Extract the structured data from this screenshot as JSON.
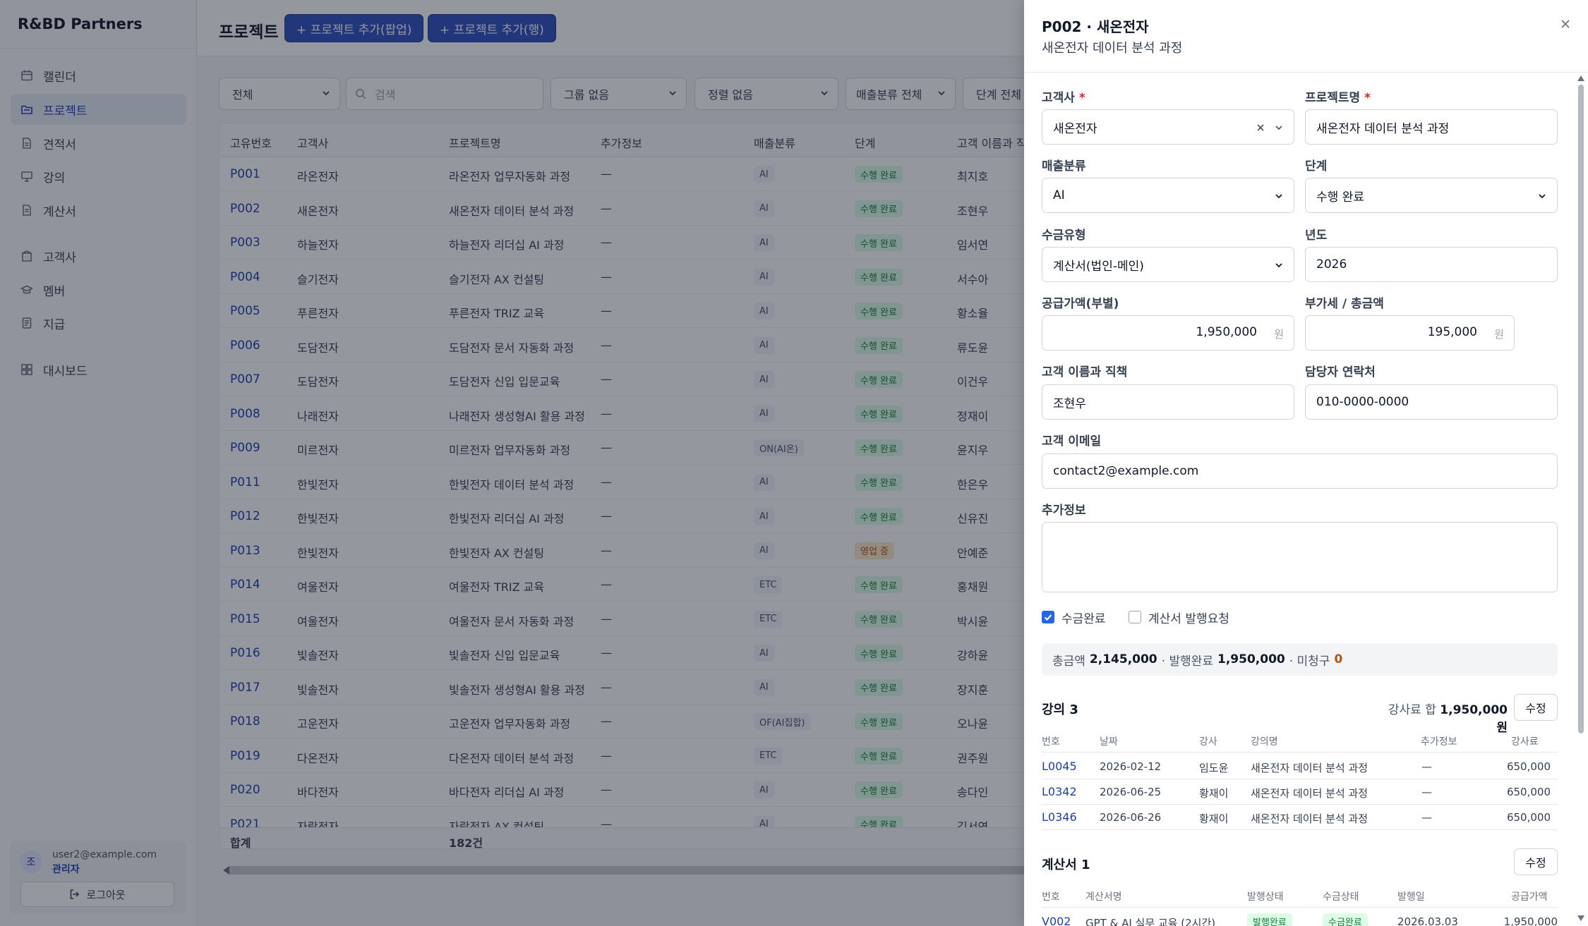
{
  "sidebar": {
    "brand": "R&BD Partners",
    "items": [
      {
        "label": "캘린더",
        "icon": "calendar-icon"
      },
      {
        "label": "프로젝트",
        "icon": "folder-icon",
        "active": true
      },
      {
        "label": "견적서",
        "icon": "document-icon"
      },
      {
        "label": "강의",
        "icon": "presentation-icon"
      },
      {
        "label": "계산서",
        "icon": "receipt-icon"
      },
      {
        "label": "고객사",
        "icon": "building-icon"
      },
      {
        "label": "멤버",
        "icon": "graduation-cap-icon"
      },
      {
        "label": "지급",
        "icon": "payment-icon"
      },
      {
        "label": "대시보드",
        "icon": "dashboard-icon"
      }
    ],
    "user": {
      "avatar": "조",
      "email": "user2@example.com",
      "role": "관리자",
      "logout": "로그아웃"
    }
  },
  "header": {
    "title": "프로젝트",
    "add_popup": "+ 프로젝트 추가(팝업)",
    "add_row": "+ 프로젝트 추가(행)"
  },
  "filters": {
    "scope": "전체",
    "search_placeholder": "검색",
    "group": "그룹 없음",
    "sort": "정렬 없음",
    "sales_class": "매출분류 전체",
    "stage": "단계 전체"
  },
  "table": {
    "columns": [
      "고유번호",
      "고객사",
      "프로젝트명",
      "추가정보",
      "매출분류",
      "단계",
      "고객 이름과 직책"
    ],
    "rows": [
      {
        "code": "P001",
        "client": "라온전자",
        "name": "라온전자 업무자동화 과정",
        "extra": "—",
        "cls": "AI",
        "stage": "수행 완료",
        "contact": "최지호"
      },
      {
        "code": "P002",
        "client": "새온전자",
        "name": "새온전자 데이터 분석 과정",
        "extra": "—",
        "cls": "AI",
        "stage": "수행 완료",
        "contact": "조현우"
      },
      {
        "code": "P003",
        "client": "하늘전자",
        "name": "하늘전자 리더십 AI 과정",
        "extra": "—",
        "cls": "AI",
        "stage": "수행 완료",
        "contact": "임서연"
      },
      {
        "code": "P004",
        "client": "슬기전자",
        "name": "슬기전자 AX 컨설팅",
        "extra": "—",
        "cls": "AI",
        "stage": "수행 완료",
        "contact": "서수아"
      },
      {
        "code": "P005",
        "client": "푸른전자",
        "name": "푸른전자 TRIZ 교육",
        "extra": "—",
        "cls": "AI",
        "stage": "수행 완료",
        "contact": "황소율"
      },
      {
        "code": "P006",
        "client": "도담전자",
        "name": "도담전자 문서 자동화 과정",
        "extra": "—",
        "cls": "AI",
        "stage": "수행 완료",
        "contact": "류도윤"
      },
      {
        "code": "P007",
        "client": "도담전자",
        "name": "도담전자 신입 입문교육",
        "extra": "—",
        "cls": "AI",
        "stage": "수행 완료",
        "contact": "이건우"
      },
      {
        "code": "P008",
        "client": "나래전자",
        "name": "나래전자 생성형AI 활용 과정",
        "extra": "—",
        "cls": "AI",
        "stage": "수행 완료",
        "contact": "정재이"
      },
      {
        "code": "P009",
        "client": "미르전자",
        "name": "미르전자 업무자동화 과정",
        "extra": "—",
        "cls": "ON(AI온)",
        "stage": "수행 완료",
        "contact": "윤지우"
      },
      {
        "code": "P011",
        "client": "한빛전자",
        "name": "한빛전자 데이터 분석 과정",
        "extra": "—",
        "cls": "AI",
        "stage": "수행 완료",
        "contact": "한은우"
      },
      {
        "code": "P012",
        "client": "한빛전자",
        "name": "한빛전자 리더십 AI 과정",
        "extra": "—",
        "cls": "AI",
        "stage": "수행 완료",
        "contact": "신유진"
      },
      {
        "code": "P013",
        "client": "한빛전자",
        "name": "한빛전자 AX 컨설팅",
        "extra": "—",
        "cls": "AI",
        "stage": "영업 중",
        "contact": "안예준"
      },
      {
        "code": "P014",
        "client": "여울전자",
        "name": "여울전자 TRIZ 교육",
        "extra": "—",
        "cls": "ETC",
        "stage": "수행 완료",
        "contact": "홍채원"
      },
      {
        "code": "P015",
        "client": "여울전자",
        "name": "여울전자 문서 자동화 과정",
        "extra": "—",
        "cls": "ETC",
        "stage": "수행 완료",
        "contact": "박시윤"
      },
      {
        "code": "P016",
        "client": "빛솔전자",
        "name": "빛솔전자 신입 입문교육",
        "extra": "—",
        "cls": "AI",
        "stage": "수행 완료",
        "contact": "강하윤"
      },
      {
        "code": "P017",
        "client": "빛솔전자",
        "name": "빛솔전자 생성형AI 활용 과정",
        "extra": "—",
        "cls": "AI",
        "stage": "수행 완료",
        "contact": "장지훈"
      },
      {
        "code": "P018",
        "client": "고운전자",
        "name": "고운전자 업무자동화 과정",
        "extra": "—",
        "cls": "OF(AI집합)",
        "stage": "수행 완료",
        "contact": "오나윤"
      },
      {
        "code": "P019",
        "client": "다온전자",
        "name": "다온전자 데이터 분석 과정",
        "extra": "—",
        "cls": "ETC",
        "stage": "수행 완료",
        "contact": "권주원"
      },
      {
        "code": "P020",
        "client": "바다전자",
        "name": "바다전자 리더십 AI 과정",
        "extra": "—",
        "cls": "AI",
        "stage": "수행 완료",
        "contact": "송다인"
      },
      {
        "code": "P021",
        "client": "자람전자",
        "name": "자람전자 AX 컨설팅",
        "extra": "—",
        "cls": "AI",
        "stage": "수행 완료",
        "contact": "김서연"
      }
    ],
    "footer": {
      "label": "합계",
      "count": "182건"
    }
  },
  "panel": {
    "title": "P002 · 새온전자",
    "subtitle": "새온전자 데이터 분석 과정",
    "fields": {
      "client_label": "고객사",
      "client_value": "새온전자",
      "project_label": "프로젝트명",
      "project_value": "새온전자 데이터 분석 과정",
      "sales_label": "매출분류",
      "sales_value": "AI",
      "stage_label": "단계",
      "stage_value": "수행 완료",
      "pay_label": "수금유형",
      "pay_value": "계산서(법인-메인)",
      "year_label": "년도",
      "year_value": "2026",
      "supply_label": "공급가액(부별)",
      "supply_value": "1,950,000",
      "vat_label": "부가세 / 총금액",
      "vat_value": "195,000",
      "unit": "원",
      "contact_label": "고객 이름과 직책",
      "contact_value": "조현우",
      "phone_label": "담당자 연락처",
      "phone_value": "010-0000-0000",
      "email_label": "고객 이메일",
      "email_value": "contact2@example.com",
      "extra_label": "추가정보",
      "required_mark": "*"
    },
    "checks": {
      "paid": "수금완료",
      "paid_on": true,
      "invoice_req": "계산서 발행요청",
      "invoice_req_on": false
    },
    "summary": {
      "total_label": "총금액",
      "total": "2,145,000",
      "issued_label": "· 발행완료",
      "issued": "1,950,000",
      "unbilled_label": "· 미청구",
      "unbilled": "0"
    },
    "lectures": {
      "title": "강의 3",
      "fee_label": "강사료 합",
      "fee_total": "1,950,000원",
      "edit": "수정",
      "columns": [
        "번호",
        "날짜",
        "강사",
        "강의명",
        "추가정보",
        "강사료"
      ],
      "rows": [
        {
          "code": "L0045",
          "date": "2026-02-12",
          "lecturer": "임도윤",
          "name": "새온전자 데이터 분석 과정",
          "extra": "—",
          "fee": "650,000"
        },
        {
          "code": "L0342",
          "date": "2026-06-25",
          "lecturer": "황재이",
          "name": "새온전자 데이터 분석 과정",
          "extra": "—",
          "fee": "650,000"
        },
        {
          "code": "L0346",
          "date": "2026-06-26",
          "lecturer": "황재이",
          "name": "새온전자 데이터 분석 과정",
          "extra": "—",
          "fee": "650,000"
        }
      ]
    },
    "invoices": {
      "title": "계산서 1",
      "edit": "수정",
      "columns": [
        "번호",
        "계산서명",
        "발행상태",
        "수금상태",
        "발행일",
        "공급가액"
      ],
      "rows": [
        {
          "code": "V002",
          "name": "GPT & AI 실무 교육 (2시간)",
          "issue": "발행완료",
          "pay": "수금완료",
          "date": "2026.03.03",
          "amount": "1,950,000"
        }
      ]
    }
  },
  "colors": {
    "primary": "#2f4fbf",
    "active_nav": "#e8ecf6",
    "stage_done": "#dcfce7",
    "stage_sales": "#fde7c8"
  }
}
